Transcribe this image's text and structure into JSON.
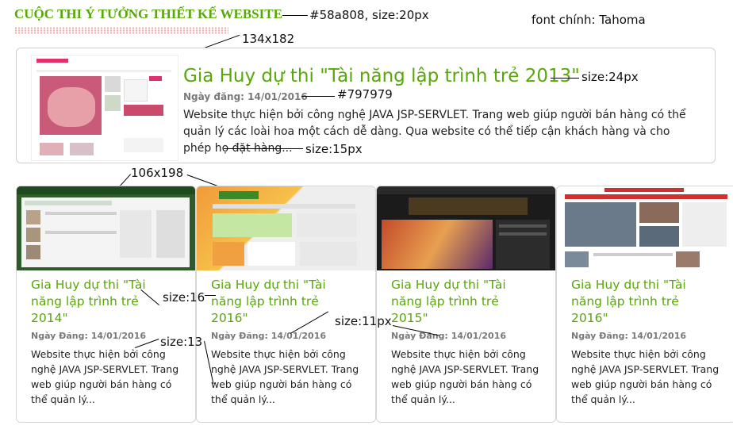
{
  "header": {
    "title": "CUỘC THI Ý TƯỞNG THIẾT KẾ WEBSITE"
  },
  "annotations": {
    "title_color": "#58a808, size:20px",
    "font_main": "font chính: Tahoma",
    "featured_thumb_size": "134x182",
    "featured_title_size": "size:24px",
    "date_color": "#797979",
    "desc_size": "size:15px",
    "card_thumb_size": "106x198",
    "card_title_size": "size:16",
    "card_date_size": "size:11px",
    "card_desc_size": "size:13"
  },
  "featured": {
    "title": "Gia Huy dự thi \"Tài năng lập trình trẻ 2013\"",
    "date": "Ngày đăng: 14/01/2016",
    "description": "Website thực hiện bởi công nghệ JAVA JSP-SERVLET. Trang web giúp người bán hàng có thể quản lý các loài hoa một cách dễ dàng. Qua website có thể tiếp cận khách hàng và cho phép họ đặt hàng..."
  },
  "cards": [
    {
      "title": "Gia Huy dự thi \"Tài năng lập trình trẻ 2014\"",
      "date": "Ngày Đăng: 14/01/2016",
      "description": "Website thực hiện bởi công nghệ JAVA JSP-SERVLET. Trang web giúp người bán hàng có thể quản lý..."
    },
    {
      "title": "Gia Huy dự thi \"Tài năng lập trình trẻ 2016\"",
      "date": "Ngày Đăng: 14/01/2016",
      "description": "Website thực hiện bởi công nghệ JAVA JSP-SERVLET. Trang web giúp người bán hàng có thể quản lý..."
    },
    {
      "title": "Gia Huy dự thi \"Tài năng lập trình trẻ 2015\"",
      "date": "Ngày Đăng: 14/01/2016",
      "description": "Website thực hiện bởi công nghệ JAVA JSP-SERVLET. Trang web giúp người bán hàng có thể quản lý..."
    },
    {
      "title": "Gia Huy dự thi \"Tài năng lập trình trẻ 2016\"",
      "date": "Ngày Đăng: 14/01/2016",
      "description": "Website thực hiện bởi công nghệ JAVA JSP-SERVLET. Trang web giúp người bán hàng có thể quản lý..."
    }
  ],
  "colors": {
    "accent_green": "#58a808",
    "date_gray": "#797979",
    "border": "#d6d6d6"
  }
}
